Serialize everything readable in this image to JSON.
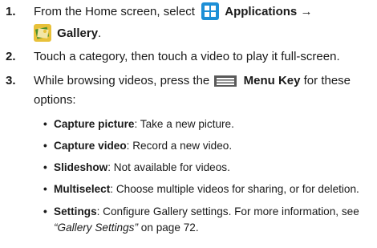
{
  "steps": [
    {
      "num": "1.",
      "pre": "From the Home screen, select",
      "app_label": "Applications",
      "arrow": "→",
      "gallery_label": "Gallery",
      "gallery_suffix": "."
    },
    {
      "num": "2.",
      "text": "Touch a category, then touch a video to play it full-screen."
    },
    {
      "num": "3.",
      "pre": "While browsing videos, press the",
      "key_label": "Menu Key",
      "post_line1": "for these",
      "line2": "options:"
    }
  ],
  "bullets": [
    {
      "term": "Capture picture",
      "desc": ": Take a new picture."
    },
    {
      "term": "Capture video",
      "desc": ": Record a new video."
    },
    {
      "term": "Slideshow",
      "desc": ": Not available for videos."
    },
    {
      "term": "Multiselect",
      "desc": ": Choose multiple videos for sharing, or for deletion."
    },
    {
      "term": "Settings",
      "desc1": ": Configure Gallery settings. For more information, see",
      "ref": "“Gallery Settings”",
      "desc2": " on page 72."
    }
  ],
  "bullet_glyph": "•",
  "icons": {
    "applications": "applications-grid-icon",
    "gallery": "gallery-icon",
    "menu_key": "menu-key-icon"
  },
  "colors": {
    "applications_blue": "#1d8fd6",
    "gallery_yellow": "#e8c13a",
    "gallery_green": "#4f8f2d",
    "menu_gray": "#5a5a5a"
  }
}
